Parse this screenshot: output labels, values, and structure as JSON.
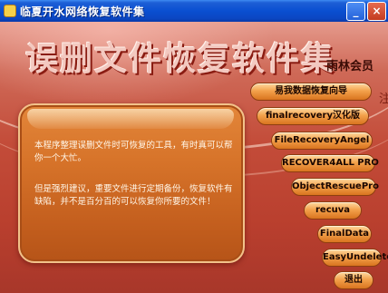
{
  "window": {
    "title": "临夏开水网络恢复软件集",
    "minimize_label": "_",
    "close_label": "×"
  },
  "banner": {
    "title": "误删文件恢复软件集",
    "author": "雨林会员",
    "side_note": "注"
  },
  "info": {
    "paragraph1": "本程序整理误删文件时可恢复的工具，有时真可以帮你一个大忙。",
    "paragraph2": "但是强烈建议，重要文件进行定期备份，恢复软件有缺陷，并不是百分百的可以恢复你所要的文件！"
  },
  "buttons": [
    {
      "label": "易我数据恢复向导"
    },
    {
      "label": "finalrecovery汉化版"
    },
    {
      "label": "FileRecoveryAngel"
    },
    {
      "label": "RECOVER4ALL PRO"
    },
    {
      "label": "ObjectRescuePro"
    },
    {
      "label": "recuva"
    },
    {
      "label": "FinalData"
    },
    {
      "label": "EasyUndelete"
    },
    {
      "label": "退出"
    }
  ]
}
